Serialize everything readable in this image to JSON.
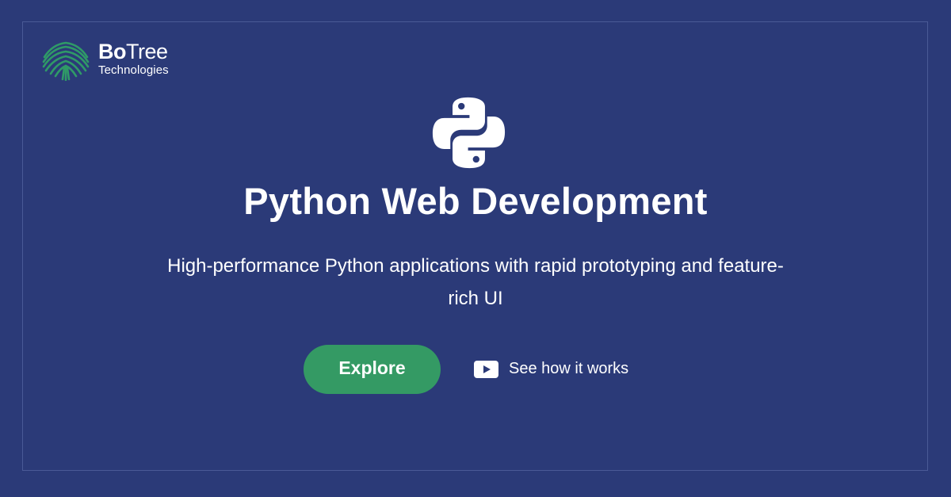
{
  "brand": {
    "name_part1": "Bo",
    "name_part2": "Tree",
    "subtitle": "Technologies",
    "logo_icon": "tree-icon",
    "logo_color": "#2f9a67"
  },
  "hero": {
    "icon": "python-logo-icon",
    "headline": "Python Web Development",
    "subline": "High-performance Python applications with rapid prototyping and feature-rich UI"
  },
  "actions": {
    "explore_label": "Explore",
    "explore_color": "#349a64",
    "how_label": "See how it works",
    "how_icon": "play-icon"
  },
  "colors": {
    "background": "#2b3a78",
    "text": "#ffffff"
  }
}
